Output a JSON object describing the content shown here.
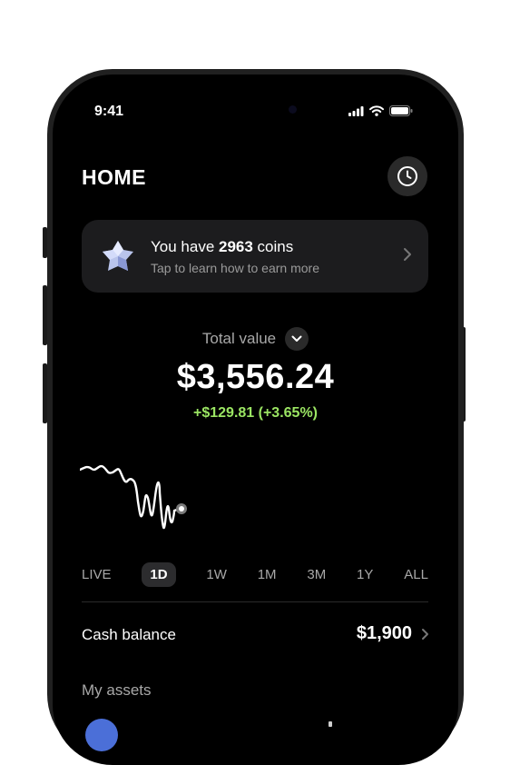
{
  "status": {
    "time": "9:41"
  },
  "header": {
    "title": "HOME",
    "history_icon": "clock-icon"
  },
  "coins_card": {
    "prefix": "You have ",
    "count": "2963",
    "suffix": " coins",
    "subtitle": "Tap to learn how to earn more",
    "icon": "gem-icon"
  },
  "portfolio": {
    "label": "Total value",
    "amount": "$3,556.24",
    "change": "+$129.81 (+3.65%)",
    "change_color": "#9be563"
  },
  "ranges": [
    "LIVE",
    "1D",
    "1W",
    "1M",
    "3M",
    "1Y",
    "ALL"
  ],
  "selected_range": "1D",
  "cash": {
    "label": "Cash balance",
    "value": "$1,900"
  },
  "assets": {
    "label": "My assets"
  },
  "colors": {
    "background": "#000000",
    "card": "#1c1c1e",
    "accent_green": "#9be563"
  }
}
